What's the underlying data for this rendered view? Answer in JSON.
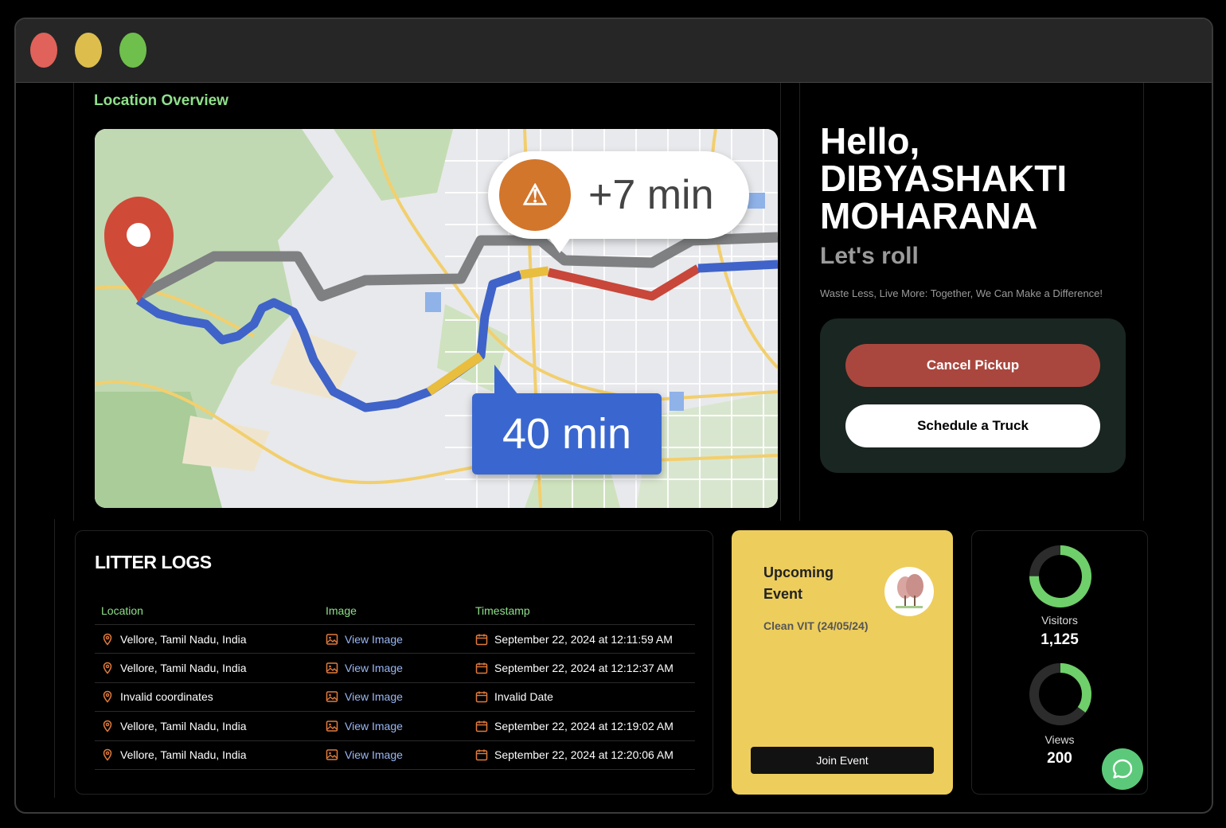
{
  "location": {
    "title": "Location Overview",
    "map": {
      "delay_badge": "+7 min",
      "eta_badge": "40 min"
    }
  },
  "greeting": {
    "hello": "Hello,",
    "name_line1": "DIBYASHAKTI",
    "name_line2": "MOHARANA",
    "subtitle": "Let's roll",
    "tagline": "Waste Less, Live More: Together, We Can Make a Difference!"
  },
  "actions": {
    "cancel_label": "Cancel Pickup",
    "schedule_label": "Schedule a Truck"
  },
  "logs": {
    "title": "LITTER LOGS",
    "columns": [
      "Location",
      "Image",
      "Timestamp"
    ],
    "rows": [
      {
        "location": "Vellore, Tamil Nadu, India",
        "image": "View Image",
        "timestamp": "September 22, 2024 at 12:11:59 AM"
      },
      {
        "location": "Vellore, Tamil Nadu, India",
        "image": "View Image",
        "timestamp": "September 22, 2024 at 12:12:37 AM"
      },
      {
        "location": "Invalid coordinates",
        "image": "View Image",
        "timestamp": "Invalid Date"
      },
      {
        "location": "Vellore, Tamil Nadu, India",
        "image": "View Image",
        "timestamp": "September 22, 2024 at 12:19:02 AM"
      },
      {
        "location": "Vellore, Tamil Nadu, India",
        "image": "View Image",
        "timestamp": "September 22, 2024 at 12:20:06 AM"
      }
    ]
  },
  "event": {
    "title": "Upcoming Event",
    "subtitle": "Clean VIT (24/05/24)",
    "join_label": "Join Event"
  },
  "stats": {
    "visitors": {
      "label": "Visitors",
      "value": "1,125",
      "fill": 0.75
    },
    "views": {
      "label": "Views",
      "value": "200",
      "fill": 0.35
    }
  },
  "colors": {
    "accent_green": "#8fe08a",
    "cancel_red": "#a9473f",
    "event_yellow": "#edcd5c",
    "ring_green": "#6fcf6a"
  }
}
